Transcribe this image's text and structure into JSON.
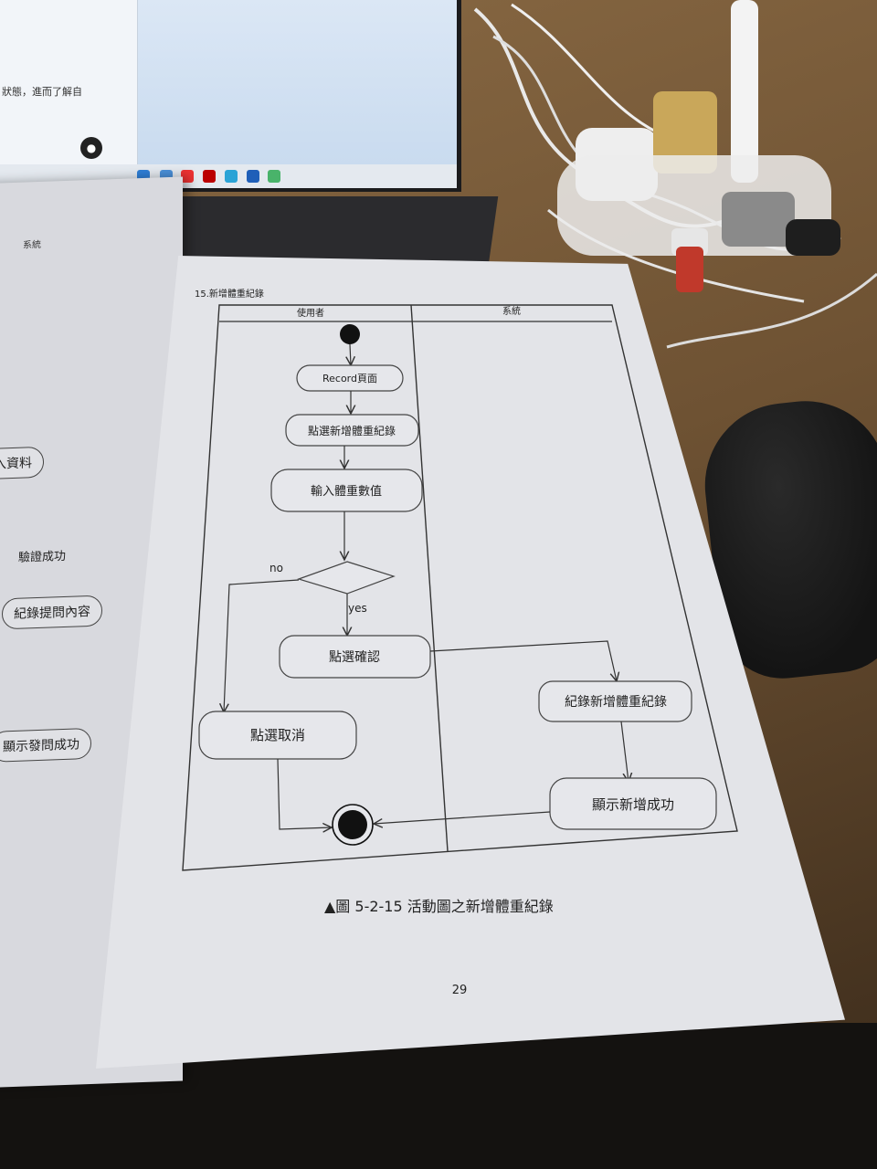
{
  "laptop": {
    "chat_text": "狀態，進而了解自",
    "mic_icon": "mic-icon"
  },
  "left_page": {
    "lane_header": "系統",
    "nodes": [
      "入資料",
      "紀錄提問內容",
      "顯示發問成功"
    ],
    "labels": [
      "驗證成功"
    ]
  },
  "page": {
    "section_title": "15.新增體重紀錄",
    "caption": "▲圖  5-2-15 活動圖之新增體重紀錄",
    "page_number": "29"
  },
  "diagram": {
    "lanes": [
      "使用者",
      "系統"
    ],
    "nodes": {
      "record_page": "Record頁面",
      "click_add": "點選新增體重紀錄",
      "input_value": "輸入體重數值",
      "click_confirm": "點選確認",
      "click_cancel": "點選取消",
      "record_new": "紀錄新增體重紀錄",
      "show_success": "顯示新增成功"
    },
    "guards": {
      "no": "no",
      "yes": "yes"
    }
  }
}
